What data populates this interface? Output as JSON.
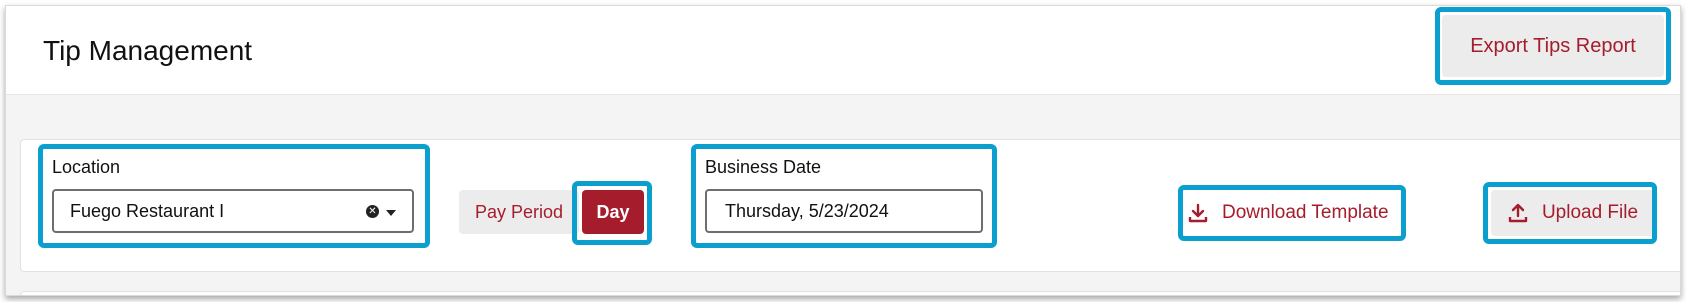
{
  "header": {
    "title": "Tip Management",
    "export_button": "Export Tips Report"
  },
  "filters": {
    "location": {
      "label": "Location",
      "value": "Fuego Restaurant I"
    },
    "period_toggle": {
      "pay_period_label": "Pay Period",
      "day_label": "Day",
      "selected": "Day"
    },
    "business_date": {
      "label": "Business Date",
      "value": "Thursday, 5/23/2024"
    },
    "download_template": {
      "label": "Download Template",
      "icon": "download-icon"
    },
    "upload_file": {
      "label": "Upload File",
      "icon": "upload-icon"
    }
  },
  "colors": {
    "accent": "#a51d2d",
    "highlight": "#0a9fce"
  }
}
